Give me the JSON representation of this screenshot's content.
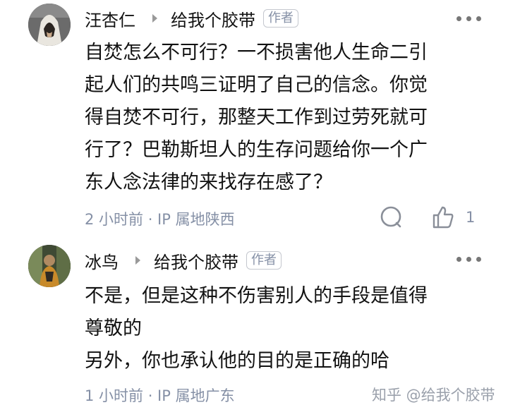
{
  "comments": [
    {
      "author": "汪杏仁",
      "reply_to": "给我个胶带",
      "badge": "作者",
      "lines": [
        "自焚怎么不可行？一不损害他人生命二引",
        "起人们的共鸣三证明了自己的信念。你觉",
        "得自焚不可行，那整天工作到过劳死就可",
        "行了？巴勒斯坦人的生存问题给你一个广",
        "东人念法律的来找存在感了？"
      ],
      "meta": "2 小时前 · IP 属地陕西",
      "like_count": "1",
      "avatar_icon": "hooded-figure-avatar"
    },
    {
      "author": "冰鸟",
      "reply_to": "给我个胶带",
      "badge": "作者",
      "lines": [
        "不是，但是这种不伤害别人的手段是值得",
        "尊敬的",
        "另外，你也承认他的目的是正确的哈"
      ],
      "meta": "1 小时前 · IP 属地广东",
      "avatar_icon": "person-photo-avatar"
    }
  ],
  "watermark": "知乎 @给我个胶带",
  "icons": {
    "reply": "comment-bubble-icon",
    "like": "thumbs-up-icon",
    "more": "more-dots-icon"
  },
  "colors": {
    "text": "#121212",
    "meta": "#8590a6",
    "background": "#ffffff"
  }
}
